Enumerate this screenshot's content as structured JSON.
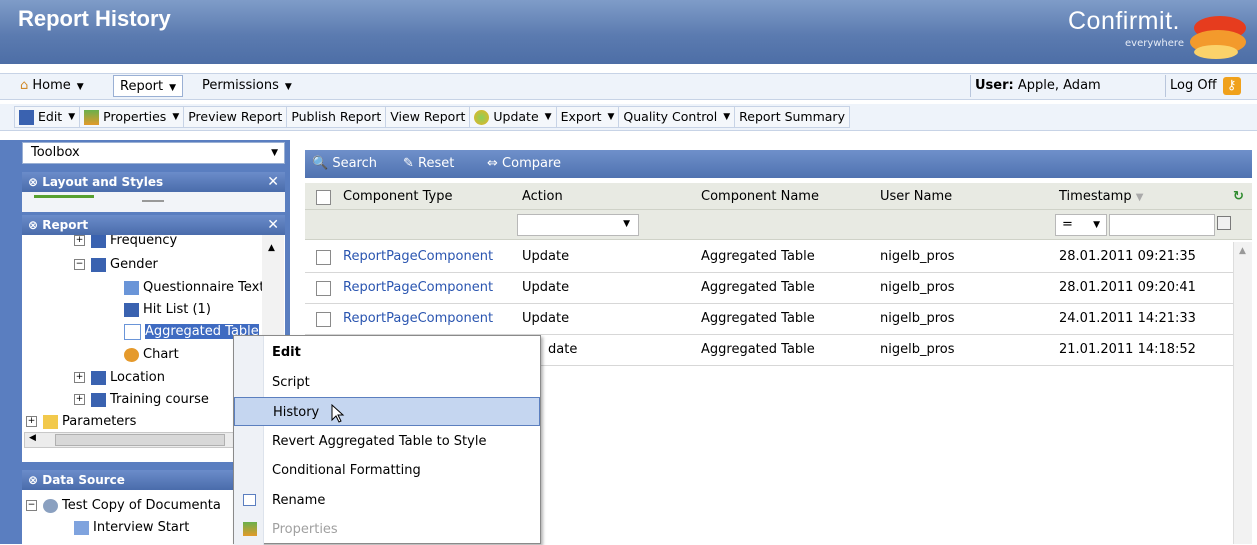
{
  "header": {
    "title": "Report History",
    "brand": "Confirmit.",
    "brand_tagline": "everywhere"
  },
  "menubar": {
    "items": [
      {
        "label": "Home"
      },
      {
        "label": "Report"
      },
      {
        "label": "Permissions"
      }
    ],
    "user_label": "User:",
    "user_name": "Apple, Adam",
    "logoff": "Log Off"
  },
  "toolbar": {
    "items": [
      {
        "label": "Edit"
      },
      {
        "label": "Properties"
      },
      {
        "label": "Preview Report"
      },
      {
        "label": "Publish Report"
      },
      {
        "label": "View Report"
      },
      {
        "label": "Update"
      },
      {
        "label": "Export"
      },
      {
        "label": "Quality Control"
      },
      {
        "label": "Report Summary"
      }
    ]
  },
  "leftpane": {
    "toolbox": "Toolbox",
    "layout_panel": "Layout and Styles",
    "report_panel": "Report",
    "tree": [
      {
        "label": "Frequency"
      },
      {
        "label": "Gender"
      },
      {
        "label": "Questionnaire Text"
      },
      {
        "label": "Hit List (1)"
      },
      {
        "label": "Aggregated Table"
      },
      {
        "label": "Chart"
      },
      {
        "label": "Location"
      },
      {
        "label": "Training course"
      },
      {
        "label": "Parameters"
      }
    ],
    "datasource_panel": "Data Source",
    "datasource_tree": [
      {
        "label": "Test Copy of Documenta"
      },
      {
        "label": "Interview Start"
      }
    ]
  },
  "grid": {
    "toolbar": {
      "search": "Search",
      "reset": "Reset",
      "compare": "Compare"
    },
    "columns": [
      "Component Type",
      "Action",
      "Component Name",
      "User Name",
      "Timestamp"
    ],
    "filter_operator": "=",
    "rows": [
      {
        "type": "ReportPageComponent",
        "action": "Update",
        "name": "Aggregated Table",
        "user": "nigelb_pros",
        "timestamp": "28.01.2011 09:21:35"
      },
      {
        "type": "ReportPageComponent",
        "action": "Update",
        "name": "Aggregated Table",
        "user": "nigelb_pros",
        "timestamp": "28.01.2011 09:20:41"
      },
      {
        "type": "ReportPageComponent",
        "action": "Update",
        "name": "Aggregated Table",
        "user": "nigelb_pros",
        "timestamp": "24.01.2011 14:21:33"
      },
      {
        "type": "",
        "action": "date",
        "name": "Aggregated Table",
        "user": "nigelb_pros",
        "timestamp": "21.01.2011 14:18:52"
      }
    ]
  },
  "context_menu": {
    "items": [
      {
        "label": "Edit"
      },
      {
        "label": "Script"
      },
      {
        "label": "History"
      },
      {
        "label": "Revert Aggregated Table to Style"
      },
      {
        "label": "Conditional Formatting"
      },
      {
        "label": "Rename"
      },
      {
        "label": "Properties"
      }
    ]
  },
  "colors": {
    "header": "#5b7bb0",
    "accent": "#3f6bc1",
    "highlight": "#c5d6f0"
  }
}
